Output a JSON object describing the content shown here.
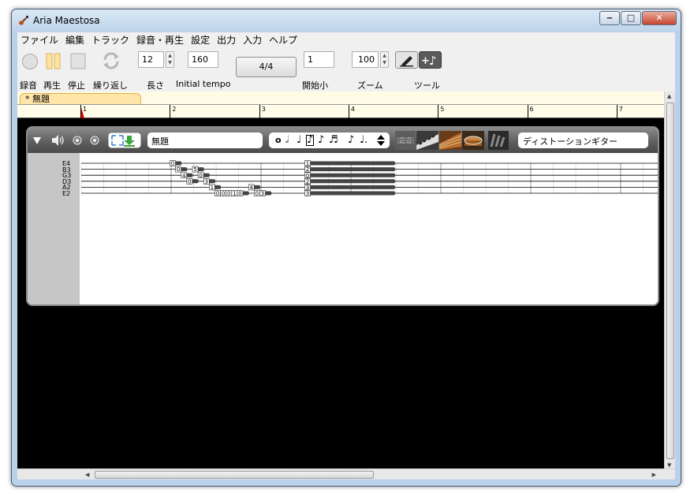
{
  "window": {
    "title": "Aria Maestosa",
    "minimize": "‒",
    "maximize": "□",
    "close": "✕"
  },
  "menu": [
    "ファイル",
    "編集",
    "トラック",
    "録音・再生",
    "設定",
    "出力",
    "入力",
    "ヘルプ"
  ],
  "toolbar": {
    "record_label": "録音",
    "play_label": "再生",
    "stop_label": "停止",
    "loop_label": "繰り返し",
    "length_value": "12",
    "length_label": "長さ",
    "tempo_value": "160",
    "tempo_label": "Initial tempo",
    "time_signature": "4/4",
    "start_measure_value": "1",
    "start_measure_label": "開始小",
    "zoom_value": "100",
    "zoom_label": "ズーム",
    "tools_label": "ツール"
  },
  "tab": {
    "label": "* 無題"
  },
  "ruler": {
    "measures": [
      "1",
      "2",
      "3",
      "4",
      "5",
      "6",
      "7"
    ]
  },
  "track": {
    "name": "無題",
    "instrument": "ディストーションギター",
    "strings": [
      "E4",
      "B3",
      "G3",
      "D3",
      "A2",
      "E2"
    ],
    "notes": [
      {
        "string": 0,
        "fret": "0",
        "beat": 0,
        "len": 0.5
      },
      {
        "string": 1,
        "fret": "0",
        "beat": 0.5,
        "len": 0.5
      },
      {
        "string": 2,
        "fret": "4",
        "beat": 1,
        "len": 0.5
      },
      {
        "string": 3,
        "fret": "0",
        "beat": 1.5,
        "len": 0.5
      },
      {
        "string": 1,
        "fret": "5",
        "beat": 2,
        "len": 0.5
      },
      {
        "string": 2,
        "fret": "0",
        "beat": 2.5,
        "len": 0.5
      },
      {
        "string": 3,
        "fret": "3",
        "beat": 3,
        "len": 0.5
      },
      {
        "string": 4,
        "fret": "1",
        "beat": 3.5,
        "len": 0.5
      },
      {
        "string": 5,
        "fret": "0",
        "beat": 4,
        "len": 0.5
      },
      {
        "string": 5,
        "fret": "0",
        "beat": 4.5,
        "len": 0.5
      },
      {
        "string": 5,
        "fret": "0",
        "beat": 5,
        "len": 0.5
      },
      {
        "string": 5,
        "fret": "1",
        "beat": 5.5,
        "len": 0.5
      },
      {
        "string": 5,
        "fret": "0",
        "beat": 6,
        "len": 0.5
      },
      {
        "string": 4,
        "fret": "4",
        "beat": 7,
        "len": 0.5
      },
      {
        "string": 5,
        "fret": "0",
        "beat": 7.5,
        "len": 0.5
      },
      {
        "string": 5,
        "fret": "3",
        "beat": 8,
        "len": 0.5
      },
      {
        "string": 0,
        "fret": "1",
        "beat": 12,
        "len": 4
      },
      {
        "string": 1,
        "fret": "2",
        "beat": 12,
        "len": 4
      },
      {
        "string": 2,
        "fret": "0",
        "beat": 12,
        "len": 4
      },
      {
        "string": 3,
        "fret": "2",
        "beat": 12,
        "len": 4
      },
      {
        "string": 4,
        "fret": "3",
        "beat": 12,
        "len": 4
      },
      {
        "string": 5,
        "fret": "3",
        "beat": 12,
        "len": 4
      }
    ]
  },
  "colors": {
    "accent_active_tool": "#5a5a5a",
    "note_fill": "#444444",
    "tab_highlight": "#ffe6a8"
  }
}
